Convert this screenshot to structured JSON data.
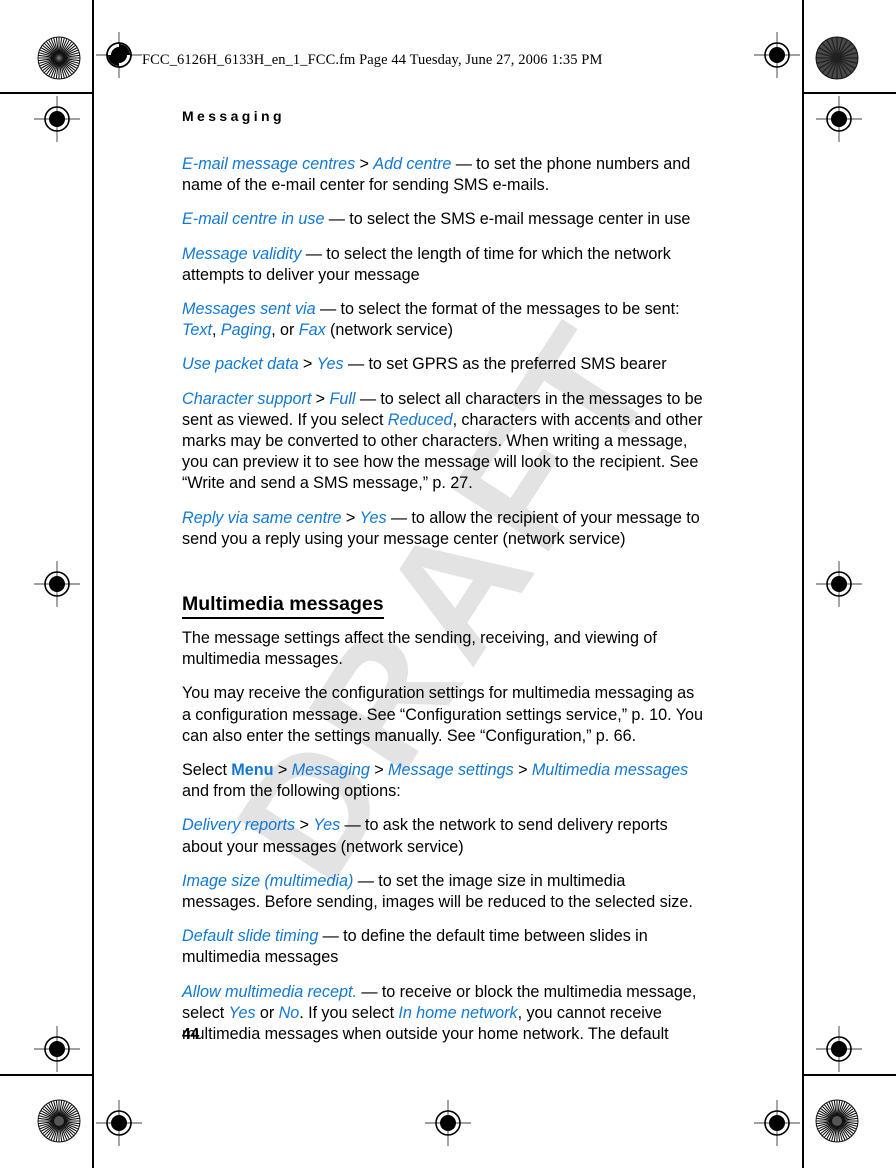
{
  "page": {
    "file_slug": "FCC_6126H_6133H_en_1_FCC.fm  Page 44  Tuesday, June 27, 2006  1:35 PM",
    "running_header": "Messaging",
    "folio": "44",
    "watermark": "DRAFT",
    "accent_color": "#1278d4",
    "watermark_color": "#e3e3e3"
  },
  "marks": {
    "registration": "registration-target-mark",
    "density": "density-starburst-mark"
  },
  "body": {
    "p1": {
      "t1": "E-mail message centres",
      "gt1": " > ",
      "t2": "Add centre",
      "rest": " — to set the phone numbers and name of the e-mail center for sending SMS e-mails."
    },
    "p2": {
      "t1": "E-mail centre in use",
      "rest": " — to select the SMS e-mail message center in use"
    },
    "p3": {
      "t1": "Message validity",
      "rest": " — to select the length of time for which the network attempts to deliver your message"
    },
    "p4": {
      "t1": "Messages sent via",
      "rest1": " — to select the format of the messages to be sent: ",
      "t2": "Text",
      "sep1": ", ",
      "t3": "Paging",
      "sep2": ", or ",
      "t4": "Fax",
      "rest2": " (network service)"
    },
    "p5": {
      "t1": "Use packet data",
      "gt1": " > ",
      "t2": "Yes",
      "rest": " — to set GPRS as the preferred SMS bearer"
    },
    "p6": {
      "t1": "Character support",
      "gt1": " > ",
      "t2": "Full",
      "rest1": " — to select all characters in the messages to be sent as viewed. If you select ",
      "t3": "Reduced",
      "rest2": ", characters with accents and other marks may be converted to other characters. When writing a message, you can preview it to see how the message will look to the recipient. See “Write and send a SMS message,” p. 27."
    },
    "p7": {
      "t1": "Reply via same centre",
      "gt1": " > ",
      "t2": "Yes",
      "rest": " — to allow the recipient of your message to send you a reply using your message center (network service)"
    },
    "heading_multimedia": "Multimedia messages",
    "p8": {
      "rest": "The message settings affect the sending, receiving, and viewing of multimedia messages."
    },
    "p9": {
      "rest": "You may receive the configuration settings for multimedia messaging as a configuration message. See “Configuration settings service,” p. 10. You can also enter the settings manually. See “Configuration,” p. 66."
    },
    "p10": {
      "lead": "Select ",
      "t1": "Menu",
      "gt1": " > ",
      "t2": "Messaging",
      "gt2": " > ",
      "t3": "Message settings",
      "gt3": " > ",
      "t4": "Multimedia messages",
      "rest": " and from the following options:"
    },
    "p11": {
      "t1": "Delivery reports",
      "gt1": " > ",
      "t2": "Yes",
      "rest": " — to ask the network to send delivery reports about your messages (network service)"
    },
    "p12": {
      "t1": "Image size (multimedia)",
      "rest": " — to set the image size in multimedia messages. Before sending, images will be reduced to the selected size."
    },
    "p13": {
      "t1": "Default slide timing",
      "rest": " — to define the default time between slides in multimedia messages"
    },
    "p14": {
      "t1": "Allow multimedia recept.",
      "rest1": " — to receive or block the multimedia message, select ",
      "t2": "Yes",
      "sep1": " or ",
      "t3": "No",
      "rest2": ". If you select ",
      "t4": "In home network",
      "rest3": ", you cannot receive multimedia messages when outside your home network. The default"
    }
  }
}
